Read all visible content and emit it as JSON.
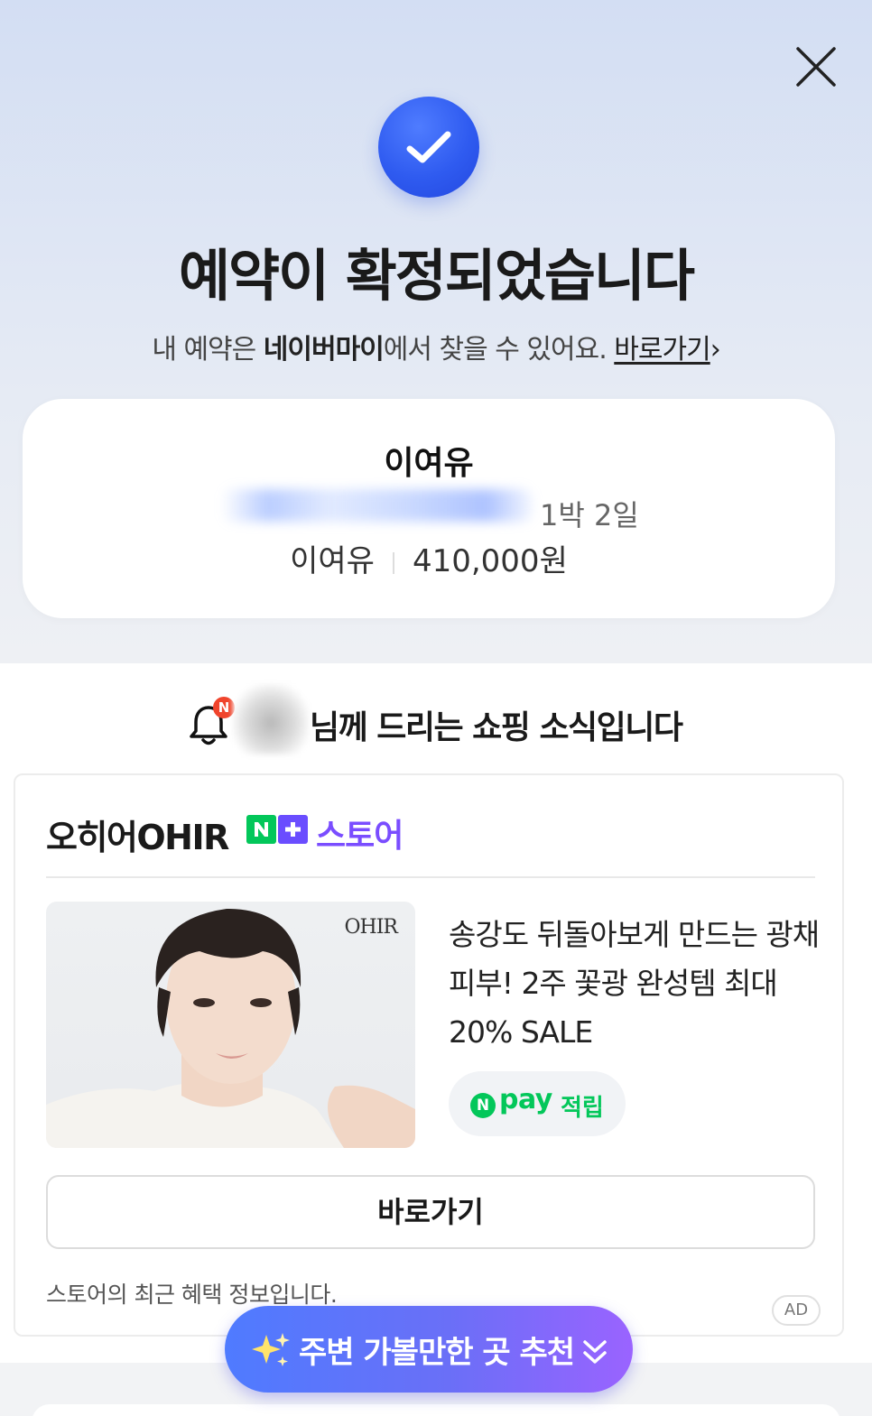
{
  "confirmation": {
    "title": "예약이 확정되었습니다",
    "subtitle_prefix": "내 예약은 ",
    "subtitle_bold": "네이버마이",
    "subtitle_suffix": "에서 찾을 수 있어요. ",
    "link_label": "바로가기",
    "link_chevron": "›"
  },
  "booking": {
    "name": "이여유",
    "nights": "1박 2일",
    "room": "이여유",
    "price": "410,000원"
  },
  "shopping": {
    "notification_badge": "N",
    "heading": "님께 드리는 쇼핑 소식입니다",
    "store_name": "오히어OHIR",
    "store_label": "스토어",
    "brand_logo": "OHIR",
    "product_description": "송강도 뒤돌아보게 만드는 광채 피부! 2주 꽃광 완성템 최대 20% SALE",
    "npay_n": "N",
    "npay_pay": "pay",
    "npay_earn": "적립",
    "go_button": "바로가기",
    "footnote": "스토어의 최근 혜택 정보입니다.",
    "ad_tag": "AD"
  },
  "recommend": {
    "label": "주변 가볼만한 곳 추천"
  },
  "colors": {
    "accent_blue": "#2f5bf0",
    "store_purple": "#7a4dff",
    "npay_green": "#03c75a",
    "nplus_green": "#03c75a"
  }
}
